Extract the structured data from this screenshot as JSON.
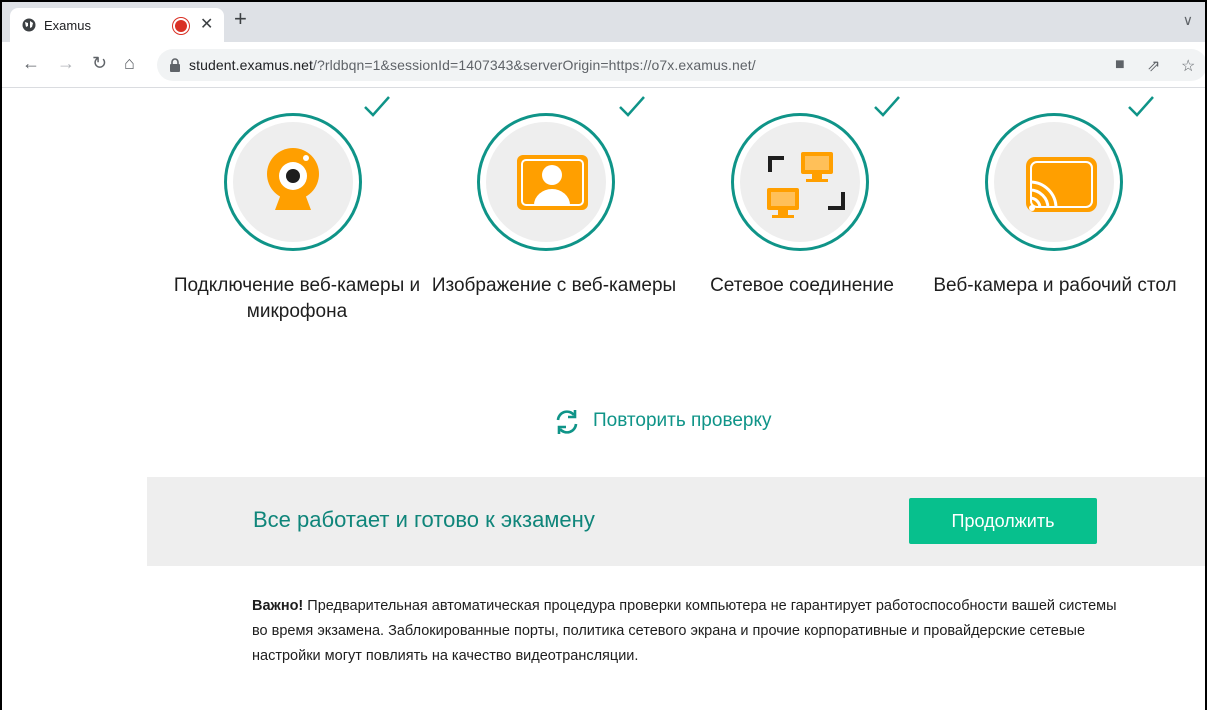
{
  "browser": {
    "tab_title": "Examus",
    "url_host": "student.examus.net",
    "url_rest": "/?rldbqn=1&sessionId=1407343&serverOrigin=https://o7x.examus.net/"
  },
  "checks": [
    {
      "label": "Подключение веб-камеры и микрофона",
      "icon": "webcam-icon"
    },
    {
      "label": "Изображение с веб-камеры",
      "icon": "user-photo-icon"
    },
    {
      "label": "Сетевое соединение",
      "icon": "network-icon"
    },
    {
      "label": "Веб-камера и рабочий стол",
      "icon": "screen-cast-icon"
    }
  ],
  "retry_label": "Повторить проверку",
  "banner": {
    "message": "Все работает и готово к экзамену",
    "continue_label": "Продолжить"
  },
  "note": {
    "bold": "Важно!",
    "text": " Предварительная автоматическая процедура проверки компьютера не гарантирует работоспособности вашей системы во время экзамена. Заблокированные порты, политика сетевого экрана и прочие корпоративные и провайдерские сетевые настройки могут повлиять на качество видеотрансляции."
  },
  "colors": {
    "accent": "#0f9488",
    "icon_orange": "#ff9f00",
    "button": "#07c08d"
  }
}
